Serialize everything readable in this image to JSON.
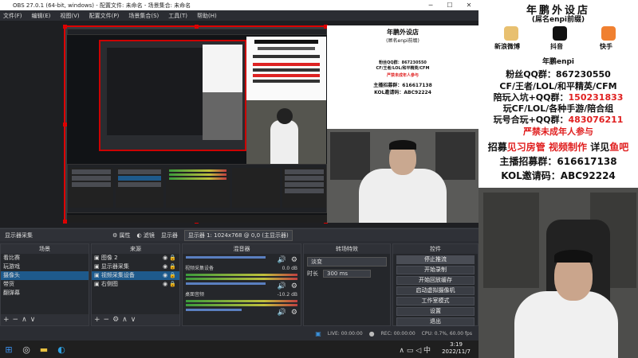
{
  "window": {
    "title": "OBS 27.0.1 (64-bit, windows) - 配置文件: 未命名 - 场景集合: 未命名"
  },
  "menu": [
    "文件(F)",
    "编辑(E)",
    "视图(V)",
    "配置文件(P)",
    "场景集合(S)",
    "工具(T)",
    "帮助(H)"
  ],
  "source_bar": {
    "selected_source": "显示器采集",
    "properties": "属性",
    "filters": "滤镜",
    "display_label": "显示器",
    "display_value": "显示器 1: 1024x768 @ 0,0 (主显示器)"
  },
  "scenes": {
    "header": "场景",
    "items": [
      "看比赛",
      "玩游戏",
      "摄像头",
      "带货",
      "翻弹幕"
    ],
    "selected": 2
  },
  "sources": {
    "header": "来源",
    "items": [
      "图像 2",
      "显示器采集",
      "视频采集设备",
      "右侧图"
    ],
    "selected": 2
  },
  "mixer": {
    "header": "混音器",
    "channels": [
      {
        "name": "视频采集设备",
        "db": "0.0 dB",
        "level": 0.72
      },
      {
        "name": "桌面音频",
        "db": "-10.2 dB",
        "level": 0.55
      }
    ]
  },
  "transitions": {
    "header": "转场特效",
    "type": "淡变",
    "duration_label": "时长",
    "duration": "300 ms"
  },
  "controls": {
    "header": "控件",
    "buttons": [
      "停止推流",
      "开始录制",
      "开始回放缓存",
      "启动虚拟摄像机",
      "工作室模式",
      "设置",
      "退出"
    ]
  },
  "status": {
    "live": "LIVE: 00:00:00",
    "rec": "REC: 00:00:00",
    "cpu": "CPU: 0.7%, 60.00 fps"
  },
  "taskbar": {
    "time": "3:19",
    "date": "2022/11/7"
  },
  "side_ad": {
    "title": "年鹏外设店",
    "subtitle": "(屌名enpi前缀)",
    "links": [
      "新浪微博",
      "抖音",
      "快手"
    ],
    "shop_name": "年鹏enpi",
    "qq_fans": "粉丝QQ群：867230550",
    "game_line": "CF/王者/LOL/和平精英/CFM",
    "wage_group": "陪玩入坑+QQ群：",
    "wage_group_num": "150231833",
    "play_line": "玩CF/LOL/各种手游/陪合组",
    "play_group": "玩号合玩+QQ群：",
    "play_group_num": "483076211",
    "warning": "严禁未成年人参与",
    "recruit_a": "招募",
    "recruit_b": "见习房管",
    "recruit_c": "视频制作",
    "recruit_d": "详见",
    "recruit_e": "鱼吧",
    "anchor": "主播招募群：616617138",
    "kol": "KOL邀请码：ABC92224"
  },
  "colors": {
    "accent": "#e02020",
    "selected": "#1e5a8c",
    "obs_bg": "#2b2d33"
  }
}
